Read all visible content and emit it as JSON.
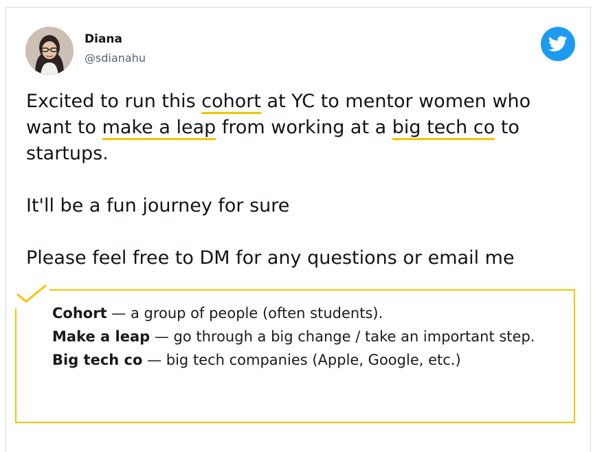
{
  "tweet": {
    "author": {
      "name": "Diana",
      "handle": "@sdianahu"
    },
    "brand_icon": "twitter-bird-icon",
    "accent_color": "#1d9bf0",
    "highlight_color": "#f5c400",
    "paragraph1": {
      "part1": "Excited to run this ",
      "hl1": "cohort",
      "part2": " at YC to mentor women who want to ",
      "hl2": "make a leap",
      "part3": " from working at a ",
      "hl3": "big tech co",
      "part4": " to startups."
    },
    "paragraph2": "It'll be a fun journey for sure",
    "paragraph3": "Please feel free to DM for any questions or email me"
  },
  "glossary": {
    "check_icon": "checkmark-icon",
    "items": [
      {
        "term": "Cohort",
        "definition": " — a group of people (often students)."
      },
      {
        "term": "Make a leap",
        "definition": " — go through a big change / take an important step."
      },
      {
        "term": "Big tech co",
        "definition": " — big tech companies (Apple, Google, etc.)"
      }
    ]
  }
}
